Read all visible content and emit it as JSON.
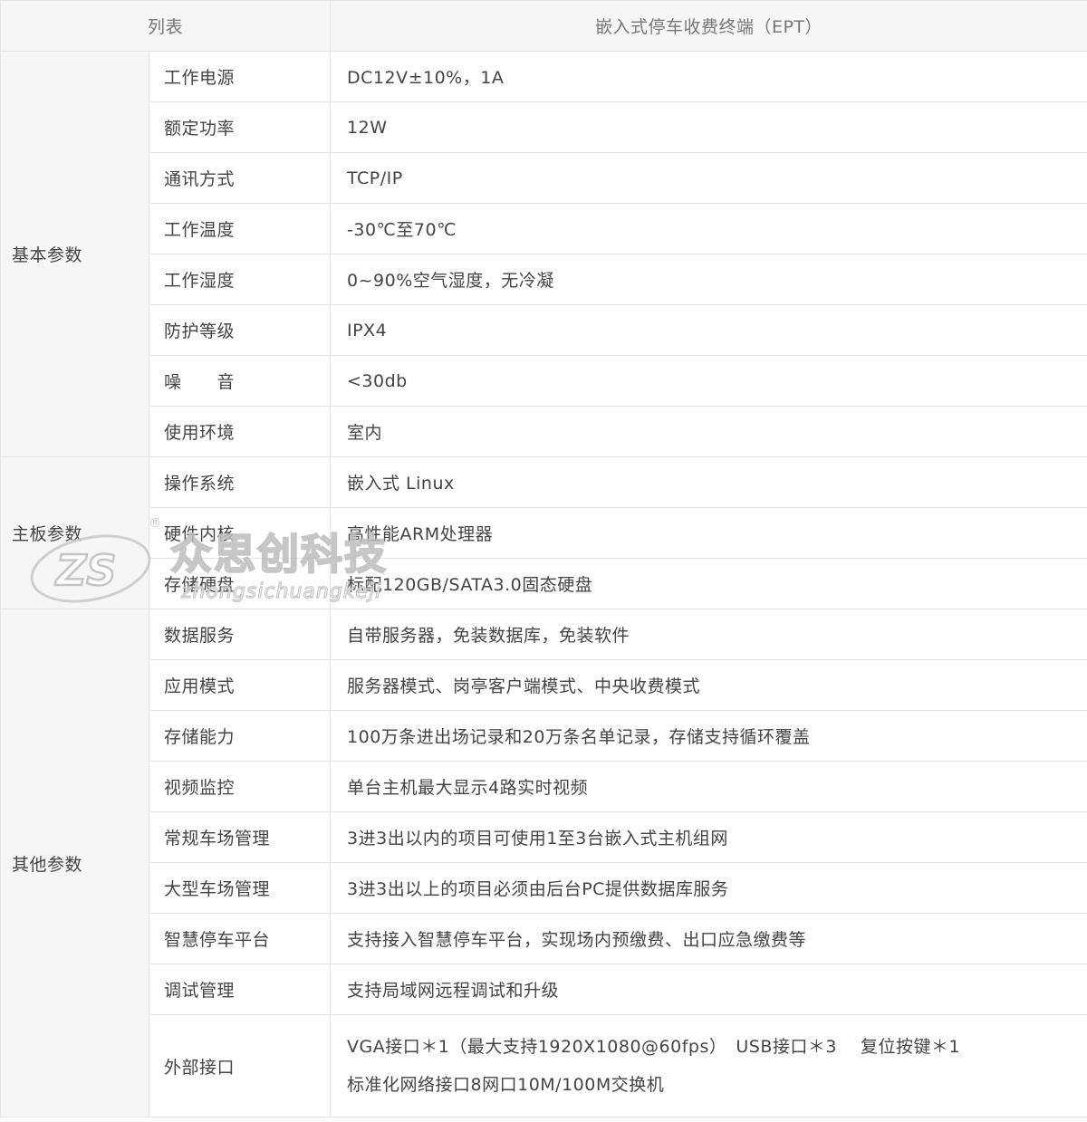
{
  "table": {
    "header": {
      "col1": "列表",
      "col2": "嵌入式停车收费终端（EPT）"
    },
    "groups": [
      {
        "name": "基本参数",
        "rows": [
          {
            "param": "工作电源",
            "value": "DC12V±10%，1A"
          },
          {
            "param": "额定功率",
            "value": "12W"
          },
          {
            "param": "通讯方式",
            "value": "TCP/IP"
          },
          {
            "param": "工作温度",
            "value": "-30℃至70℃"
          },
          {
            "param": "工作湿度",
            "value": "0~90%空气湿度，无冷凝"
          },
          {
            "param": "防护等级",
            "value": "IPX4"
          },
          {
            "param": "噪　　音",
            "value": "<30db"
          },
          {
            "param": "使用环境",
            "value": "室内"
          }
        ]
      },
      {
        "name": "主板参数",
        "rows": [
          {
            "param": "操作系统",
            "value": "嵌入式 Linux"
          },
          {
            "param": "硬件内核",
            "value": "高性能ARM处理器"
          },
          {
            "param": "存储硬盘",
            "value": "标配120GB/SATA3.0固态硬盘"
          }
        ]
      },
      {
        "name": "其他参数",
        "rows": [
          {
            "param": "数据服务",
            "value": "自带服务器，免装数据库，免装软件"
          },
          {
            "param": "应用模式",
            "value": "服务器模式、岗亭客户端模式、中央收费模式"
          },
          {
            "param": "存储能力",
            "value": "100万条进出场记录和20万条名单记录，存储支持循环覆盖"
          },
          {
            "param": "视频监控",
            "value": "单台主机最大显示4路实时视频"
          },
          {
            "param": "常规车场管理",
            "value": "3进3出以内的项目可使用1至3台嵌入式主机组网"
          },
          {
            "param": "大型车场管理",
            "value": "3进3出以上的项目必须由后台PC提供数据库服务"
          },
          {
            "param": "智慧停车平台",
            "value": "支持接入智慧停车平台，实现场内预缴费、出口应急缴费等"
          },
          {
            "param": "调试管理",
            "value": "支持局域网远程调试和升级"
          },
          {
            "param": "外部接口",
            "value_line1": "VGA接口＊1（最大支持1920X1080@60fps）　USB接口＊3　 复位按键＊1",
            "value_line2": "标准化网络接口8网口10M/100M交换机"
          }
        ]
      }
    ]
  },
  "watermark": {
    "logo_letters": "ZS",
    "brand_text": "众思创科技",
    "brand_pinyin": "zhongsichuangkeji",
    "registered_mark": "®",
    "color": "#cccccc"
  }
}
